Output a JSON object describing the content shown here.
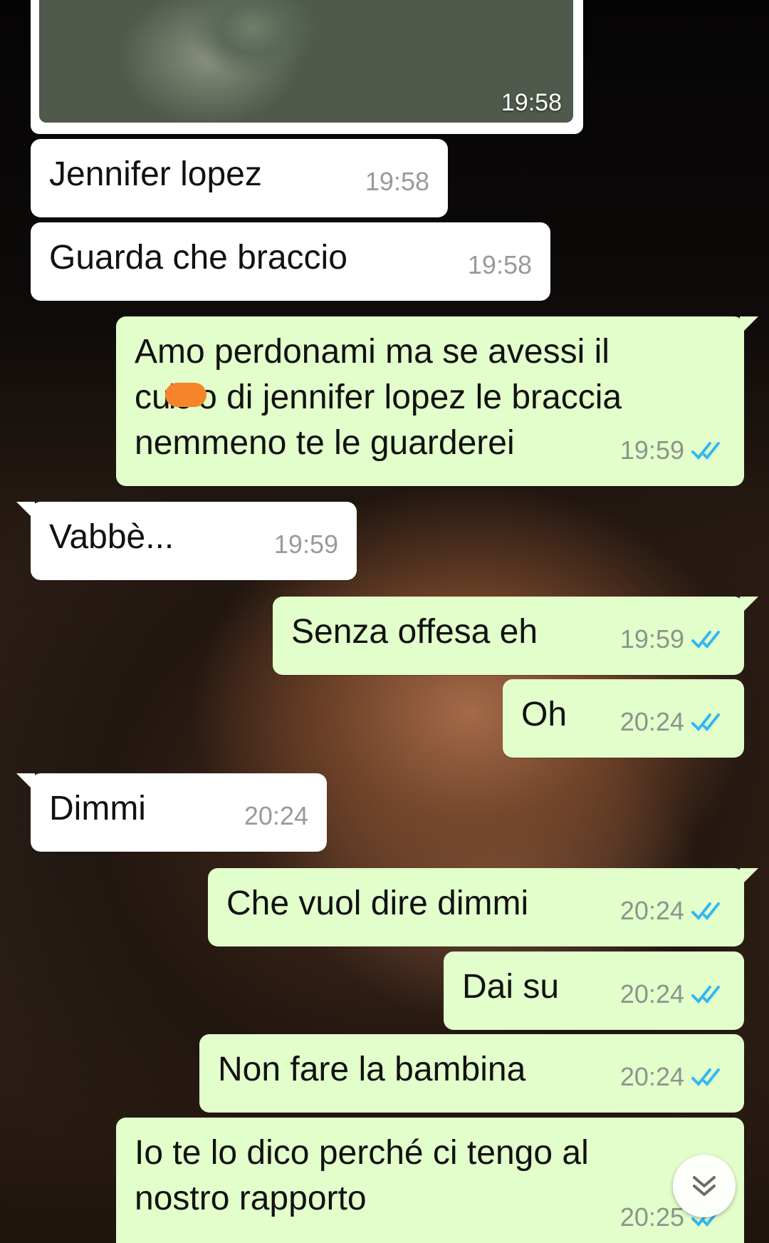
{
  "image_message": {
    "time": "19:58"
  },
  "messages": [
    {
      "direction": "incoming",
      "text": "Jennifer lopez",
      "time": "19:58"
    },
    {
      "direction": "incoming",
      "text": "Guarda che braccio",
      "time": "19:58"
    },
    {
      "direction": "outgoing",
      "text_line1": "Amo perdonami ma se avessi il",
      "text_line2_start": "c",
      "text_line2_hidden": "ulo",
      "text_line2_end": "o di jennifer lopez le braccia",
      "text_line3": "nemmeno te le guarderei",
      "time": "19:59",
      "status": "read"
    },
    {
      "direction": "incoming",
      "text": "Vabbè...",
      "time": "19:59"
    },
    {
      "direction": "outgoing",
      "text": "Senza offesa eh",
      "time": "19:59",
      "status": "read"
    },
    {
      "direction": "outgoing",
      "text": "Oh",
      "time": "20:24",
      "status": "read"
    },
    {
      "direction": "incoming",
      "text": "Dimmi",
      "time": "20:24"
    },
    {
      "direction": "outgoing",
      "text": "Che vuol dire dimmi",
      "time": "20:24",
      "status": "read"
    },
    {
      "direction": "outgoing",
      "text": "Dai su",
      "time": "20:24",
      "status": "read"
    },
    {
      "direction": "outgoing",
      "text": "Non fare la bambina",
      "time": "20:24",
      "status": "read"
    },
    {
      "direction": "outgoing",
      "text": "Io te lo dico perché ci tengo al nostro rapporto",
      "time": "20:25",
      "status": "read"
    }
  ],
  "icons": {
    "read_receipt": "double-check-icon",
    "scroll_down": "chevron-double-down-icon"
  },
  "colors": {
    "incoming_bubble": "#ffffff",
    "outgoing_bubble": "#e2fecb",
    "read_tick": "#34b7f1",
    "redaction": "#f5842a"
  }
}
